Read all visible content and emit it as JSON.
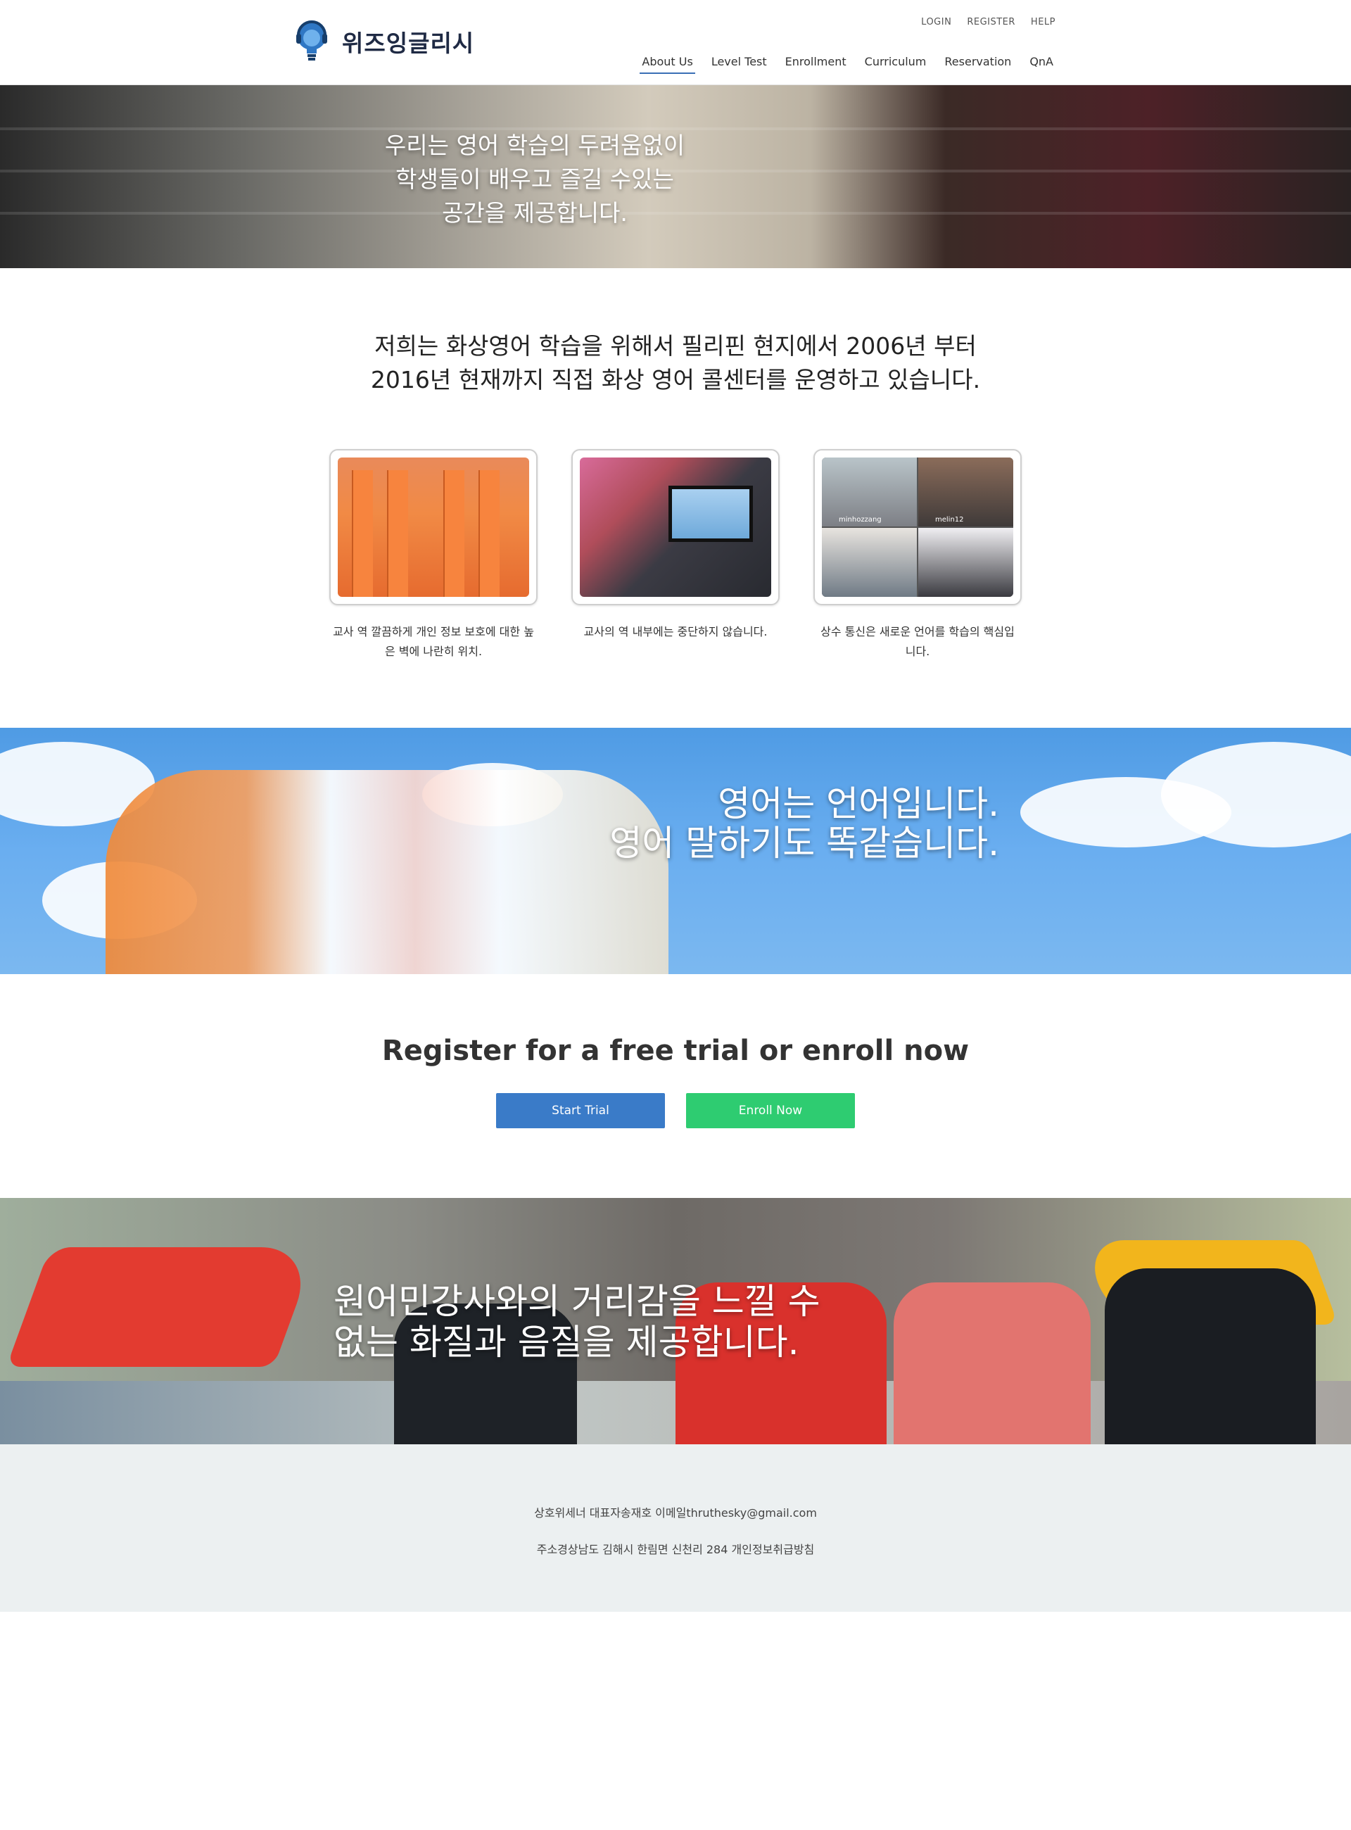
{
  "header": {
    "logo_text": "위즈잉글리시",
    "util_nav": [
      "LOGIN",
      "REGISTER",
      "HELP"
    ],
    "main_nav": [
      "About Us",
      "Level Test",
      "Enrollment",
      "Curriculum",
      "Reservation",
      "QnA"
    ],
    "active_nav": "About Us"
  },
  "hero": {
    "lines": [
      "우리는 영어 학습의 두려움없이",
      "학생들이 배우고 즐길 수있는",
      "공간을 제공합니다."
    ]
  },
  "intro": {
    "lines": [
      "저희는 화상영어 학습을 위해서 필리핀 현지에서 2006년 부터",
      "2016년 현재까지 직접 화상 영어 콜센터를 운영하고 있습니다."
    ]
  },
  "cards": [
    {
      "caption": "교사 역 깔끔하게 개인 정보 보호에 대한 높은 벽에 나란히 위치."
    },
    {
      "caption": "교사의 역 내부에는 중단하지 않습니다."
    },
    {
      "caption": "상수 통신은 새로운 언어를 학습의 핵심입니다.",
      "video_labels": [
        "minhozzang",
        "melin12"
      ]
    }
  ],
  "sky_banner": {
    "lines": [
      "영어는 언어입니다.",
      "영어 말하기도 똑같습니다."
    ]
  },
  "cta": {
    "title": "Register for a free trial or enroll now",
    "trial_label": "Start Trial",
    "enroll_label": "Enroll Now",
    "colors": {
      "trial": "#3a7bc8",
      "enroll": "#2ecc71"
    }
  },
  "play_banner": {
    "lines": [
      "원어민강사와의 거리감을 느낄 수",
      "없는 화질과 음질을 제공합니다."
    ]
  },
  "footer": {
    "line1": "상호위세너 대표자송재호 이메일thruthesky@gmail.com",
    "line2": "주소경상남도 김해시 한림면 신천리 284 개인정보취급방침"
  }
}
